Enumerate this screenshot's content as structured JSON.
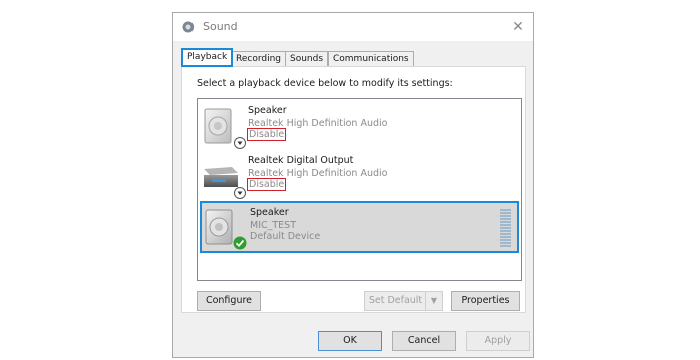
{
  "window": {
    "title": "Sound",
    "close_glyph": "✕"
  },
  "tabs": [
    {
      "label": "Playback",
      "active": true
    },
    {
      "label": "Recording",
      "active": false
    },
    {
      "label": "Sounds",
      "active": false
    },
    {
      "label": "Communications",
      "active": false
    }
  ],
  "instruction": "Select a playback device below to modify its settings:",
  "devices": [
    {
      "name": "Speaker",
      "driver": "Realtek High Definition Audio",
      "status": "Disable",
      "icon": "speaker-icon",
      "badge": "down-arrow-badge-icon"
    },
    {
      "name": "Realtek Digital Output",
      "driver": "Realtek High Definition Audio",
      "status": "Disable",
      "icon": "digital-output-icon",
      "badge": "down-arrow-badge-icon"
    },
    {
      "name": "Speaker",
      "driver": "MIC_TEST",
      "status": "Default Device",
      "icon": "speaker-icon",
      "badge": "green-check-badge-icon",
      "selected": true
    }
  ],
  "buttons": {
    "configure": "Configure",
    "set_default": "Set Default",
    "set_default_arrow": "▼",
    "properties": "Properties",
    "ok": "OK",
    "cancel": "Cancel",
    "apply": "Apply"
  },
  "colors": {
    "accent": "#1e88d8",
    "disabled_outline": "#d0202a",
    "check_green": "#2e9e2e"
  }
}
